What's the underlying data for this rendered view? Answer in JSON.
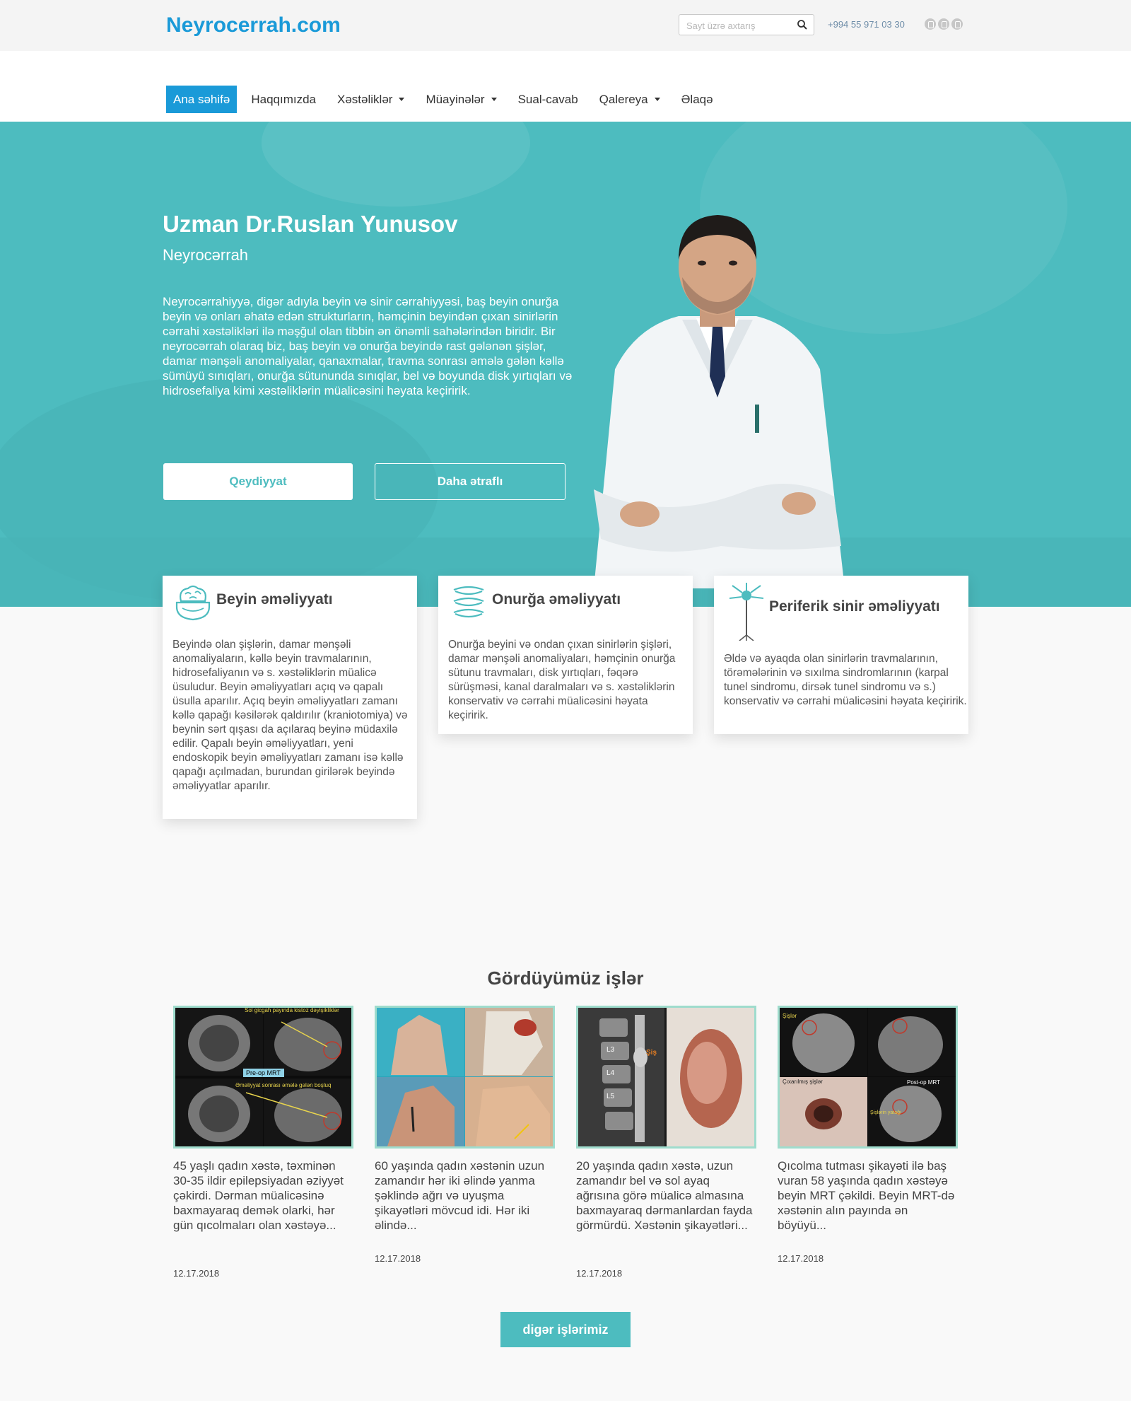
{
  "header": {
    "logo": "Neyrocerrah.com",
    "search_placeholder": "Sayt üzrə axtarış",
    "phone": "+994 55 971 03 30",
    "social_icons": [
      "facebook-icon",
      "instagram-icon",
      "youtube-icon"
    ]
  },
  "nav": {
    "items": [
      {
        "label": "Ana səhifə",
        "active": true,
        "dropdown": false
      },
      {
        "label": "Haqqımızda",
        "active": false,
        "dropdown": false
      },
      {
        "label": "Xəstəliklər",
        "active": false,
        "dropdown": true
      },
      {
        "label": "Müayinələr",
        "active": false,
        "dropdown": true
      },
      {
        "label": "Sual-cavab",
        "active": false,
        "dropdown": false
      },
      {
        "label": "Qalereya",
        "active": false,
        "dropdown": true
      },
      {
        "label": "Əlaqə",
        "active": false,
        "dropdown": false
      }
    ]
  },
  "hero": {
    "title": "Uzman Dr.Ruslan Yunusov",
    "subtitle": "Neyrocərrah",
    "text": "Neyrocərrahiyyə, digər adıyla beyin və sinir cərrahiyyəsi, baş beyin onurğa beyin və onları əhatə edən strukturların, həmçinin beyindən çıxan sinirlərin cərrahi xəstəlikləri ilə məşğul olan tibbin ən önəmli sahələrindən biridir. Bir neyrocərrah olaraq biz, baş beyin və onurğa beyində rast gələnən şişlər, damar mənşəli anomaliyalar, qanaxmalar, travma sonrası əmələ gələn kəllə sümüyü sınıqları, onurğa sütununda sınıqlar, bel və boyunda disk yırtıqları və hidrosefaliya kimi xəstəliklərin müalicəsini həyata keçiririk.",
    "register_button": "Qeydiyyat",
    "more_button": "Daha ətraflı"
  },
  "services": [
    {
      "title": "Beyin əməliyyatı",
      "icon": "brain-icon",
      "text": "Beyində olan şişlərin, damar mənşəli anomaliyaların, kəllə beyin travmalarının, hidrosefaliyanın və s. xəstəliklərin müalicə üsuludur. Beyin əməliyyatları açıq və qapalı üsulla aparılır. Açıq beyin əməliyyatları zamanı kəllə qapağı kəsilərək qaldırılır (kraniotomiya) və beynin sərt qışası da açılaraq beyinə müdaxilə edilir. Qapalı beyin əməliyyatları, yeni endoskopik beyin əməliyyatları zamanı isə kəllə qapağı açılmadan, burundan girilərək beyində əməliyyatlar aparılır."
    },
    {
      "title": "Onurğa əməliyyatı",
      "icon": "spine-icon",
      "text": "Onurğa beyini və ondan çıxan sinirlərin şişləri, damar mənşəli anomaliyaları, həmçinin onurğa sütunu travmaları, disk yırtıqları, fəqərə sürüşməsi, kanal daralmaları və s. xəstəliklərin konservativ və cərrahi müalicəsini həyata keçiririk."
    },
    {
      "title": "Periferik sinir əməliyyatı",
      "icon": "neuron-icon",
      "text": "Əldə və ayaqda olan sinirlərin travmalarının, törəmələrinin və sıxılma sindromlarının (karpal tunel sindromu, dirsək tunel sindromu və s.) konservativ və cərrahi müalicəsini həyata keçiririk."
    }
  ],
  "works": {
    "title": "Gördüyümüz işlər",
    "items": [
      {
        "desc": "45 yaşlı qadın xəstə, təxminən 30-35 ildir epilepsiyadan əziyyət çəkirdi. Dərman müalicəsinə baxmayaraq demək olarki, hər gün qıcolmaları olan xəstəyə...",
        "date": "12.17.2018",
        "image_labels": [
          "Sol gicgah payında kistoz dəyişikliklər",
          "Pre-op MRT",
          "Əməliyyat sonrası əmələ gələn boşluq"
        ]
      },
      {
        "desc": "60 yaşında qadın xəstənin uzun zamandır hər iki əlində yanma şəklində ağrı və uyuşma şikayətləri mövcud idi. Hər iki əlində...",
        "date": "12.17.2018",
        "image_labels": []
      },
      {
        "desc": "20 yaşında qadın xəstə, uzun zamandır bel və sol ayaq ağrısına görə müalicə almasına baxmayaraq dərmanlardan fayda görmürdü. Xəstənin şikayətləri...",
        "date": "12.17.2018",
        "image_labels": [
          "L3",
          "L4",
          "L5",
          "Şiş"
        ]
      },
      {
        "desc": "Qıcolma tutması şikayəti ilə baş vuran 58 yaşında qadın xəstəyə beyin MRT çəkildi. Beyin MRT-də xəstənin alın payında ən böyüyü...",
        "date": "12.17.2018",
        "image_labels": [
          "Şişlər",
          "Çıxarılmış şişlər",
          "Post-op MRT",
          "Şişlərin yatağı"
        ]
      }
    ],
    "more_button": "digər işlərimiz"
  },
  "colors": {
    "brand_blue": "#1a9ad8",
    "teal": "#4dbcbf",
    "thumb_border": "#9fdccd"
  }
}
